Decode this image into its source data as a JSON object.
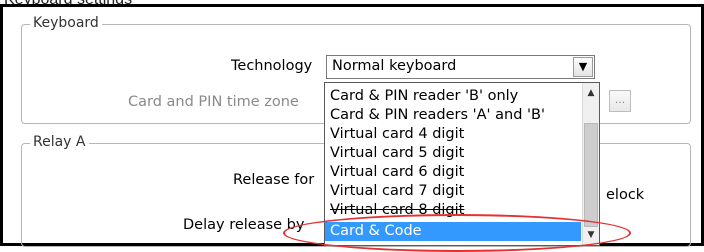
{
  "page_heading": "Keyboard settings",
  "keyboard": {
    "legend": "Keyboard",
    "technology_label": "Technology",
    "technology_value": "Normal keyboard",
    "timezone_label": "Card and PIN time zone",
    "browse_button": "..."
  },
  "relay": {
    "legend": "Relay A",
    "release_label": "Release for",
    "delay_label": "Delay release by",
    "relock_text": "elock"
  },
  "dropdown": {
    "options": [
      "Card & PIN reader 'B' only",
      "Card & PIN readers 'A' and 'B'",
      "Virtual card 4 digit",
      "Virtual card 5 digit",
      "Virtual card 6 digit",
      "Virtual card 7 digit",
      "Virtual card 8 digit",
      "Card & Code"
    ],
    "selected": "Card & Code"
  },
  "colors": {
    "selection": "#3399ff",
    "annotation": "#e23333"
  },
  "icons": {
    "select_arrow": "chevron-down-icon",
    "scroll_up": "chevron-up-icon",
    "scroll_down": "chevron-down-icon"
  }
}
